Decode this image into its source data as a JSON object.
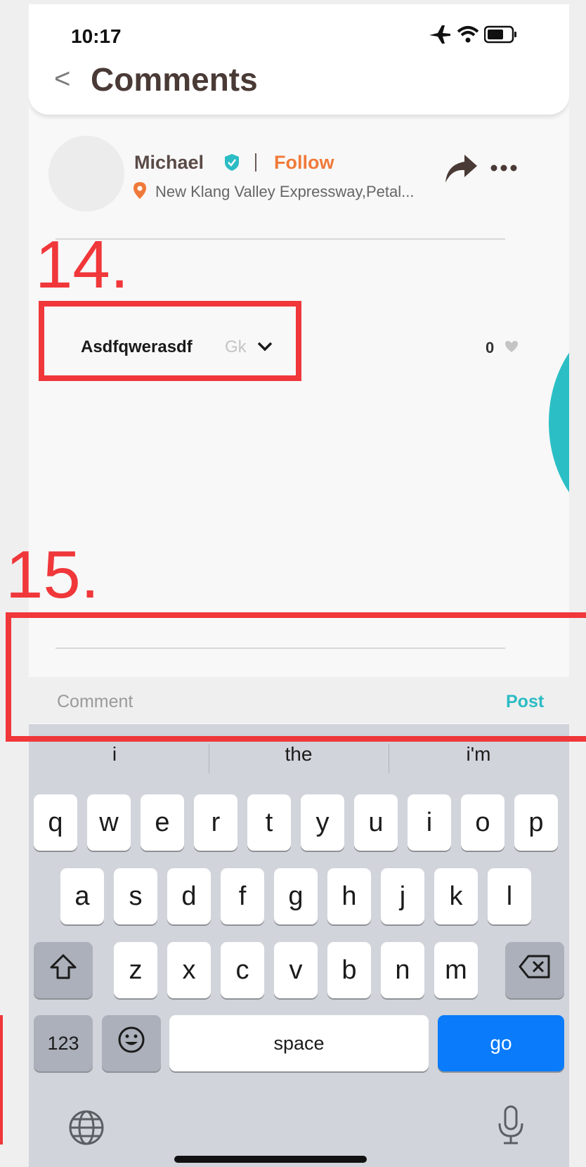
{
  "status_bar": {
    "time": "10:17"
  },
  "header": {
    "title": "Comments"
  },
  "post": {
    "author": "Michael",
    "follow_label": "Follow",
    "location": "New Klang Valley Expressway,Petal..."
  },
  "comment": {
    "username": "Asdfqwerasdf",
    "time": "Gk",
    "likes": "0"
  },
  "comment_input": {
    "placeholder": "Comment",
    "post_label": "Post"
  },
  "keyboard": {
    "suggestions": [
      "i",
      "the",
      "i'm"
    ],
    "row1": [
      "q",
      "w",
      "e",
      "r",
      "t",
      "y",
      "u",
      "i",
      "o",
      "p"
    ],
    "row2": [
      "a",
      "s",
      "d",
      "f",
      "g",
      "h",
      "j",
      "k",
      "l"
    ],
    "row3": [
      "z",
      "x",
      "c",
      "v",
      "b",
      "n",
      "m"
    ],
    "numbers_label": "123",
    "space_label": "space",
    "go_label": "go"
  },
  "annotations": {
    "label_14": "14.",
    "label_15": "15."
  },
  "colors": {
    "accent_follow": "#f07a3a",
    "accent_post": "#2cbcc4",
    "annotation_red": "#f0373a",
    "keyboard_go": "#0a7bfa"
  }
}
